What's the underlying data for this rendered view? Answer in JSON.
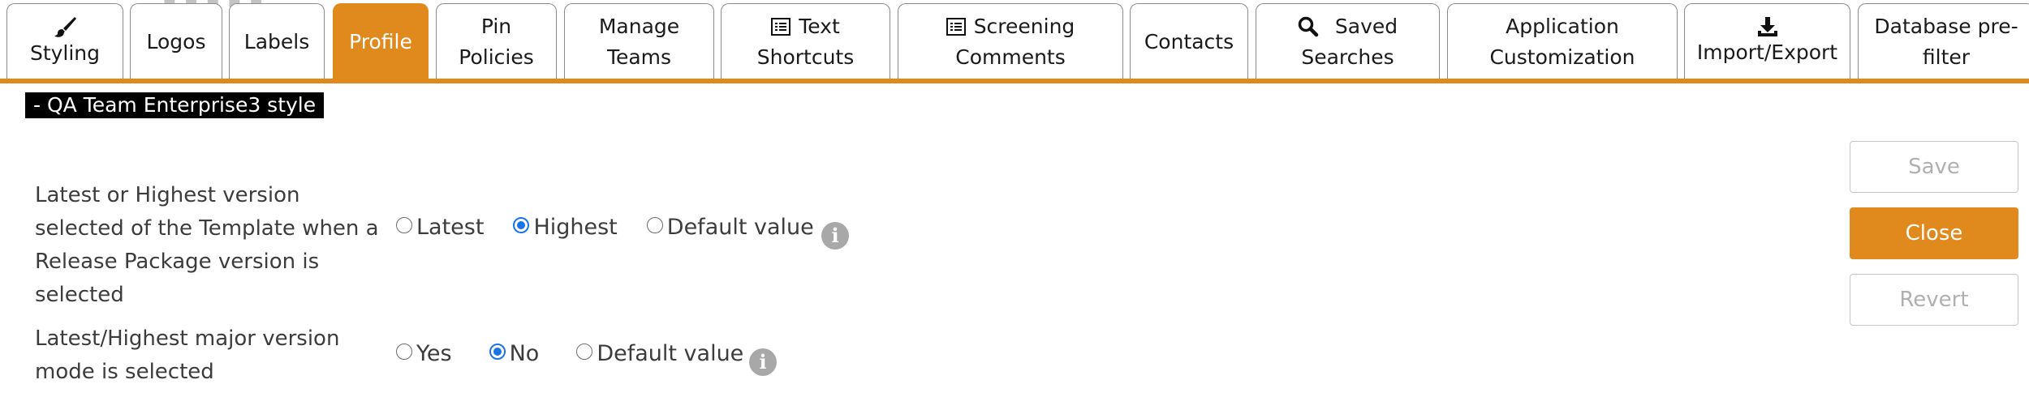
{
  "tabs": [
    {
      "label": "Styling",
      "icon": "brush-icon",
      "active": false
    },
    {
      "label": "Logos",
      "active": false
    },
    {
      "label": "Labels",
      "active": false
    },
    {
      "label": "Profile",
      "active": true
    },
    {
      "label_line1": "Pin",
      "label_line2": "Policies",
      "active": false
    },
    {
      "label_line1": "Manage",
      "label_line2": "Teams",
      "active": false
    },
    {
      "label_line1": "Text",
      "label_line2": "Shortcuts",
      "icon": "list-icon",
      "active": false
    },
    {
      "label_line1": "Screening",
      "label_line2": "Comments",
      "icon": "list-icon",
      "active": false
    },
    {
      "label": "Contacts",
      "active": false
    },
    {
      "label_line1": "Saved",
      "label_line2": "Searches",
      "icon": "search-icon",
      "active": false
    },
    {
      "label_line1": "Application",
      "label_line2": "Customization",
      "active": false
    },
    {
      "label": "Import/Export",
      "icon": "download-icon",
      "active": false
    },
    {
      "label_line1": "Database pre-",
      "label_line2": "filter",
      "active": false
    }
  ],
  "style_title": "- QA Team Enterprise3 style",
  "settings": [
    {
      "label": "Latest or Highest version selected of the Template when a Release Package version is selected",
      "options": [
        "Latest",
        "Highest",
        "Default value"
      ],
      "selected": "Highest",
      "info_icon": "info-icon"
    },
    {
      "label": "Latest/Highest major version mode is selected",
      "options": [
        "Yes",
        "No",
        "Default value"
      ],
      "selected": "No",
      "info_icon": "info-icon"
    }
  ],
  "buttons": {
    "save": "Save",
    "close": "Close",
    "revert": "Revert"
  },
  "colors": {
    "accent": "#e08a1e",
    "radio_checked": "#1a73e8",
    "title_bg": "#000000",
    "disabled_text": "#b0b0b0"
  }
}
